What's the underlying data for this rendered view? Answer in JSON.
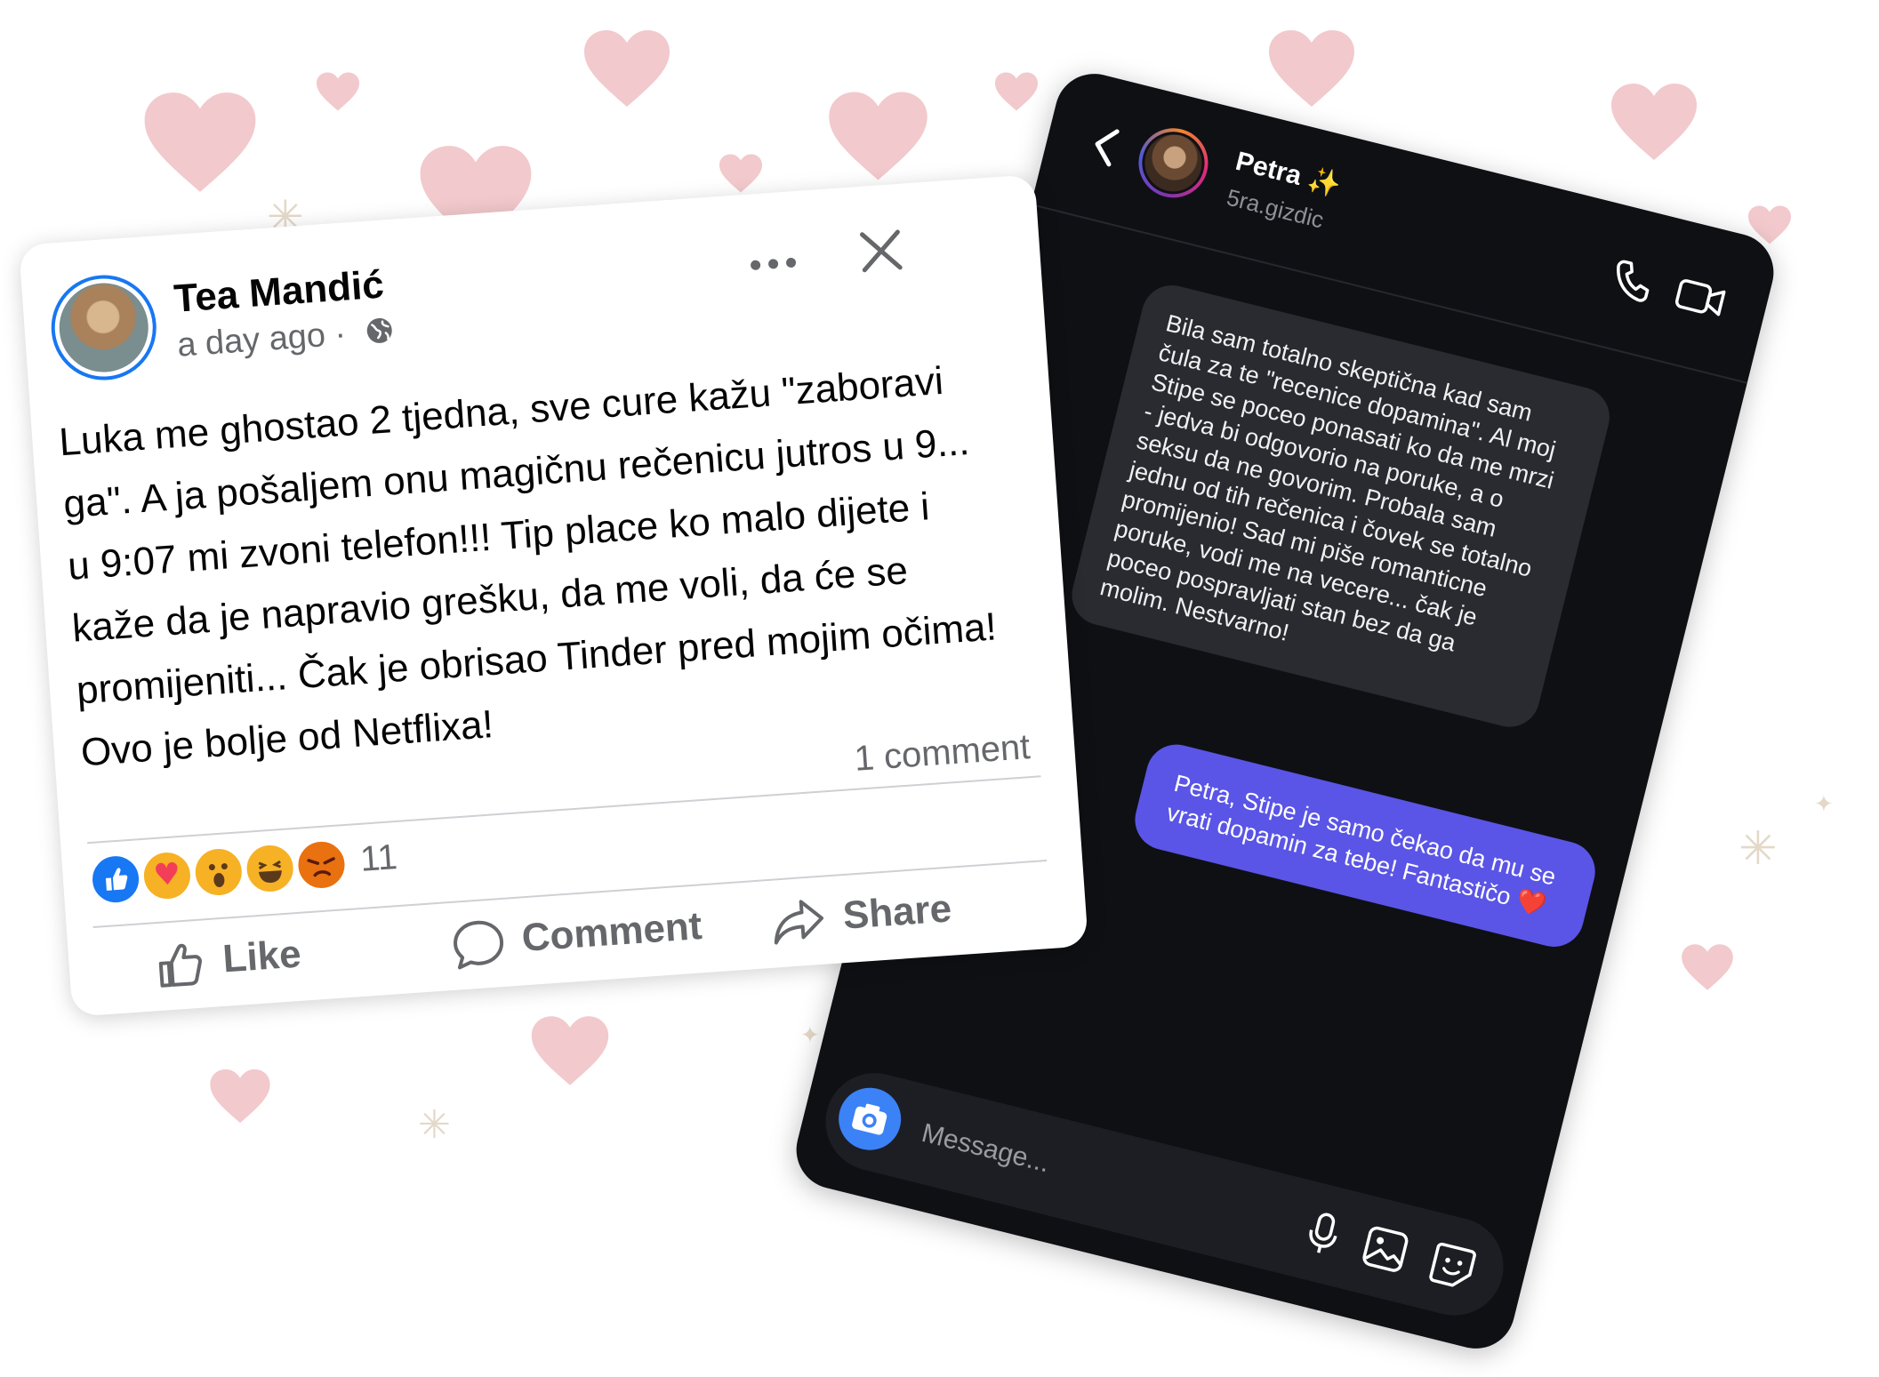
{
  "background": {
    "heart_color": "#f2c9cc",
    "sparkle_glyph": "✳"
  },
  "facebook_post": {
    "author": "Tea Mandić",
    "time": "a day ago",
    "separator": "·",
    "body": "Luka me ghostao 2 tjedna, sve cure kažu \"zaboravi ga\".  A ja pošaljem onu magičnu rečenicu jutros u 9... u 9:07 mi zvoni telefon!!! Tip place ko malo dijete i kaže da je napravio grešku, da me voli, da će se promijeniti... Čak je obrisao Tinder pred mojim očima! Ovo je bolje od Netflixa!",
    "comment_count": "1 comment",
    "reaction_count": "11",
    "reactions": [
      "like",
      "care",
      "wow",
      "haha",
      "angry"
    ],
    "actions": {
      "like": "Like",
      "comment": "Comment",
      "share": "Share"
    },
    "colors": {
      "accent": "#1877f2",
      "secondary_text": "#65676b"
    }
  },
  "chat": {
    "contact_name": "Petra",
    "contact_emoji": "✨",
    "contact_handle": "5ra.gizdic",
    "incoming_message": "Bila sam totalno skeptična kad sam čula za te \"recenice dopamina\". Al moj Stipe se poceo ponasati ko da me mrzi - jedva bi odgovorio na poruke, a o seksu da ne govorim. Probala sam jednu od tih rečenica i čovek se totalno promijenio! Sad mi piše romanticne poruke, vodi me na vecere... čak je poceo pospravljati stan bez da ga molim. Nestvarno!",
    "outgoing_message": "Petra, Stipe je samo čekao da mu se vrati dopamin za tebe! Fantastičo ❤️",
    "message_placeholder": "Message...",
    "colors": {
      "background": "#0f1014",
      "incoming_bubble": "#2a2b31",
      "outgoing_bubble": "#5a55e6",
      "camera_button": "#3b82f6"
    }
  }
}
